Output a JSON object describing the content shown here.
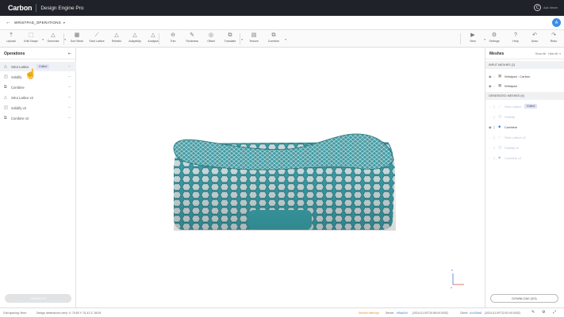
{
  "app": {
    "brand": "Carbon",
    "product": "Design Engine Pro",
    "user_initial": "C",
    "user_label": "Add Viewer",
    "avatar_initial": "A"
  },
  "project": {
    "back": "←",
    "name": "WRISTPAD_OPERATIONS",
    "caret": "▾"
  },
  "toolbar": {
    "tools": [
      {
        "label": "Upload",
        "icon": "⤒"
      },
      {
        "label": "Edit Shape",
        "icon": "⬚"
      },
      {
        "label": "Generate",
        "icon": "△"
      },
      {
        "label": "Surf Mesh",
        "icon": "▦"
      },
      {
        "label": "Strut Lattice",
        "icon": "⟋"
      },
      {
        "label": "Rebeltz",
        "icon": "△"
      },
      {
        "label": "Adaptivity",
        "icon": "△"
      },
      {
        "label": "Analysis",
        "icon": "△"
      },
      {
        "label": "Trim",
        "icon": "⊖"
      },
      {
        "label": "Thickness",
        "icon": "✎"
      },
      {
        "label": "Offset",
        "icon": "◎"
      },
      {
        "label": "Translate",
        "icon": "⧉"
      },
      {
        "label": "Texture",
        "icon": "▤"
      },
      {
        "label": "Combine",
        "icon": "⧉"
      },
      {
        "label": "View",
        "icon": "▶"
      },
      {
        "label": "Settings",
        "icon": "⚙"
      },
      {
        "label": "Help",
        "icon": "?"
      },
      {
        "label": "Undo",
        "icon": "↶"
      },
      {
        "label": "Redo",
        "icon": "↷"
      }
    ]
  },
  "operations": {
    "title": "Operations",
    "collapse": "⇤",
    "items": [
      {
        "label": "Strut Lattice",
        "icon": "△",
        "badge": "Edited"
      },
      {
        "label": "Solidify",
        "icon": "◫"
      },
      {
        "label": "Combine",
        "icon": "⧉"
      },
      {
        "label": "Strut Lattice v2",
        "icon": "△"
      },
      {
        "label": "Solidify v2",
        "icon": "◫"
      },
      {
        "label": "Combine v2",
        "icon": "⧉"
      }
    ],
    "more": "···",
    "generate_label": "GENERATE"
  },
  "meshes": {
    "title": "Meshes",
    "links": "Show All  ·  Hide All  ⇥",
    "input_header": "INPUT MESHES (2)",
    "input_items": [
      {
        "label": "Wristpad - Carbon"
      },
      {
        "label": "Wristpad"
      }
    ],
    "generated_header": "GENERATED MESHES (6)",
    "generated_items": [
      {
        "label": "Strut Lattice",
        "badge": "Edited",
        "dim": true
      },
      {
        "label": "Solidify",
        "dim": true
      },
      {
        "label": "Combine",
        "dim": false
      },
      {
        "label": "Strut Lattice v2",
        "dim": true
      },
      {
        "label": "Solidify v2",
        "dim": true
      },
      {
        "label": "Combine v2",
        "dim": true
      }
    ],
    "download_label": "DOWNLOAD (3/3)"
  },
  "status": {
    "grid": "Grid spacing: 5mm",
    "dims": "Design dimensions (mm): X: 76.80  Y: 31.42  Z: 38.09",
    "warn": "Service Interrupt",
    "server_label": "Server:",
    "server_val": "ef5ad1fd",
    "server_date": "(2024-01-09T10:58:04.000Z)",
    "client_label": "Client:",
    "client_val": "a1c92ba0",
    "client_date": "(2024-01-09T12:51:00.000Z)"
  },
  "colors": {
    "teal": "#3aa0a8",
    "lattice": "#2b7f86",
    "topbar": "#1f2228",
    "accent": "#3a8ee6"
  }
}
